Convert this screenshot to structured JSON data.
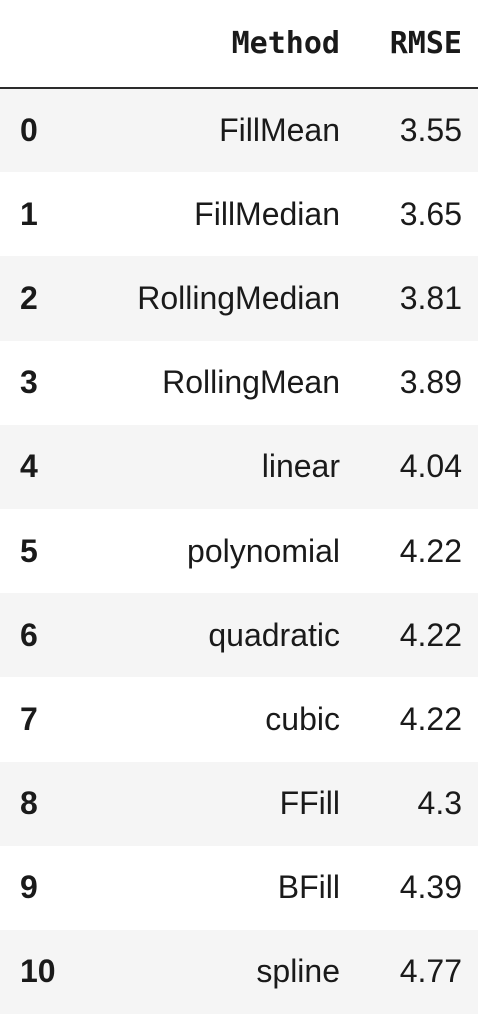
{
  "table": {
    "columns": [
      "",
      "Method",
      "RMSE"
    ],
    "rows": [
      {
        "index": "0",
        "method": "FillMean",
        "rmse": "3.55"
      },
      {
        "index": "1",
        "method": "FillMedian",
        "rmse": "3.65"
      },
      {
        "index": "2",
        "method": "RollingMedian",
        "rmse": "3.81"
      },
      {
        "index": "3",
        "method": "RollingMean",
        "rmse": "3.89"
      },
      {
        "index": "4",
        "method": "linear",
        "rmse": "4.04"
      },
      {
        "index": "5",
        "method": "polynomial",
        "rmse": "4.22"
      },
      {
        "index": "6",
        "method": "quadratic",
        "rmse": "4.22"
      },
      {
        "index": "7",
        "method": "cubic",
        "rmse": "4.22"
      },
      {
        "index": "8",
        "method": "FFill",
        "rmse": "4.3"
      },
      {
        "index": "9",
        "method": "BFill",
        "rmse": "4.39"
      },
      {
        "index": "10",
        "method": "spline",
        "rmse": "4.77"
      }
    ]
  }
}
